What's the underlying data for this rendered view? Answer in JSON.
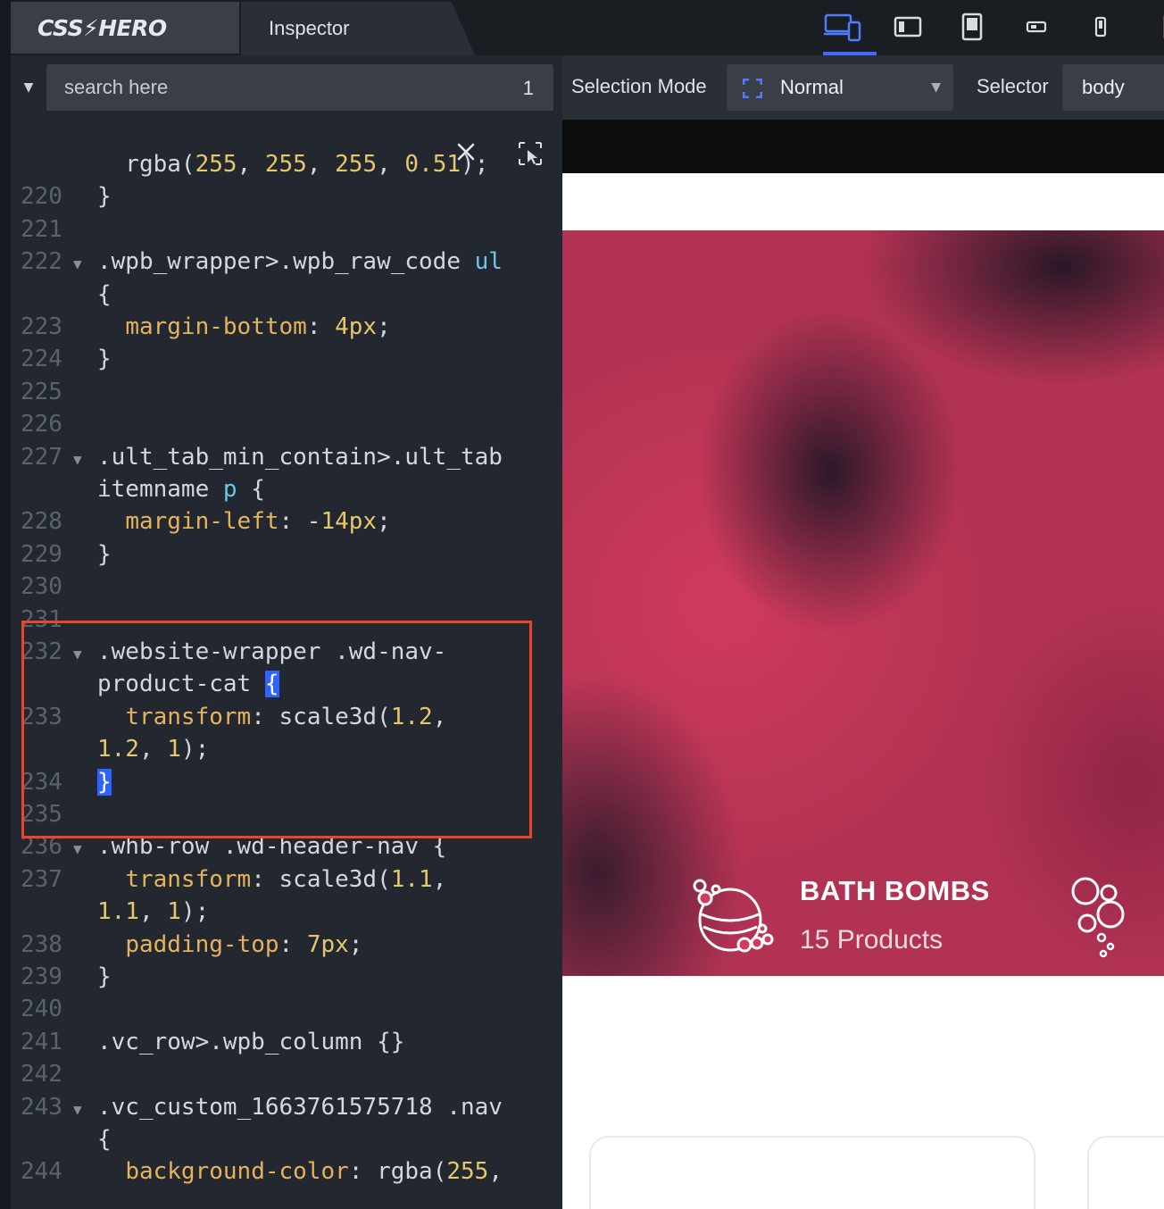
{
  "sidebar": {
    "logo": "CSS⚡HERO",
    "tab_inspector": "Inspector",
    "search": {
      "placeholder": "search here",
      "count": "1"
    }
  },
  "code_lines": [
    {
      "num": "",
      "text": "  rgba(255, 255, 255, 0.51);"
    },
    {
      "num": "220",
      "text": "}"
    },
    {
      "num": "221",
      "text": ""
    },
    {
      "num": "222",
      "text": ".wpb_wrapper>.wpb_raw_code ul"
    },
    {
      "num": "",
      "text": "{"
    },
    {
      "num": "223",
      "text": "  margin-bottom: 4px;"
    },
    {
      "num": "224",
      "text": "}"
    },
    {
      "num": "225",
      "text": ""
    },
    {
      "num": "226",
      "text": ""
    },
    {
      "num": "227",
      "text": ".ult_tab_min_contain>.ult_tab"
    },
    {
      "num": "",
      "text": "itemname p {"
    },
    {
      "num": "228",
      "text": "  margin-left: -14px;"
    },
    {
      "num": "229",
      "text": "}"
    },
    {
      "num": "230",
      "text": ""
    },
    {
      "num": "231",
      "text": ""
    },
    {
      "num": "232",
      "text": ".website-wrapper .wd-nav-"
    },
    {
      "num": "",
      "text": "product-cat {"
    },
    {
      "num": "233",
      "text": "  transform: scale3d(1.2,"
    },
    {
      "num": "",
      "text": "1.2, 1);"
    },
    {
      "num": "234",
      "text": "}"
    },
    {
      "num": "235",
      "text": ""
    },
    {
      "num": "236",
      "text": ".whb-row .wd-header-nav {"
    },
    {
      "num": "237",
      "text": "  transform: scale3d(1.1,"
    },
    {
      "num": "",
      "text": "1.1, 1);"
    },
    {
      "num": "238",
      "text": "  padding-top: 7px;"
    },
    {
      "num": "239",
      "text": "}"
    },
    {
      "num": "240",
      "text": ""
    },
    {
      "num": "241",
      "text": ".vc_row>.wpb_column {}"
    },
    {
      "num": "242",
      "text": ""
    },
    {
      "num": "243",
      "text": ".vc_custom_1663761575718 .nav"
    },
    {
      "num": "",
      "text": "{"
    },
    {
      "num": "244",
      "text": "  background-color: rgba(255,"
    }
  ],
  "toolbar": {
    "selection_mode_label": "Selection Mode",
    "selection_mode_value": "Normal",
    "selector_label": "Selector",
    "selector_value": "body"
  },
  "preview": {
    "category_title": "BATH BOMBS",
    "category_count": "15 Products"
  },
  "colors": {
    "accent": "#3b6cff",
    "highlight_border": "#e8452c",
    "hero_pink": "#cf3a5d"
  }
}
